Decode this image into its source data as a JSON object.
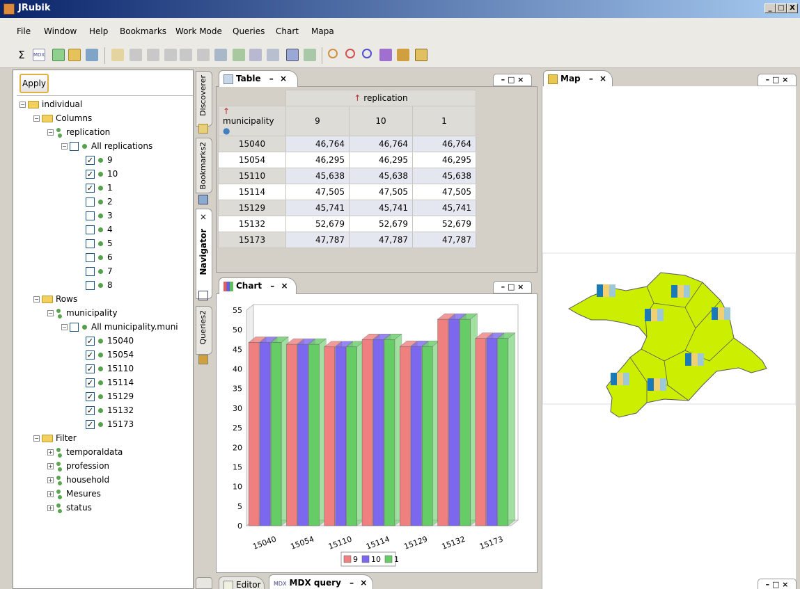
{
  "app": {
    "title": "JRubik"
  },
  "window_buttons": {
    "minimize": "_",
    "maximize": "□",
    "close": "X"
  },
  "menu": [
    "File",
    "Window",
    "Help",
    "Bookmarks",
    "Work Mode",
    "Queries",
    "Chart",
    "Mapa"
  ],
  "toolbar": {
    "sigma_label": "Σ",
    "mdx_label": "MDX"
  },
  "navigator": {
    "apply_label": "Apply",
    "tree": [
      {
        "label": "individual",
        "kind": "folder",
        "level": 0,
        "exp": "−"
      },
      {
        "label": "Columns",
        "kind": "folder",
        "level": 1,
        "exp": "−"
      },
      {
        "label": "replication",
        "kind": "dim",
        "level": 2,
        "exp": "−"
      },
      {
        "label": "All replications",
        "kind": "member",
        "level": 3,
        "exp": "−",
        "checked": false
      },
      {
        "label": "9",
        "kind": "member",
        "level": 4,
        "checked": true
      },
      {
        "label": "10",
        "kind": "member",
        "level": 4,
        "checked": true
      },
      {
        "label": "1",
        "kind": "member",
        "level": 4,
        "checked": true
      },
      {
        "label": "2",
        "kind": "member",
        "level": 4,
        "checked": false
      },
      {
        "label": "3",
        "kind": "member",
        "level": 4,
        "checked": false
      },
      {
        "label": "4",
        "kind": "member",
        "level": 4,
        "checked": false
      },
      {
        "label": "5",
        "kind": "member",
        "level": 4,
        "checked": false
      },
      {
        "label": "6",
        "kind": "member",
        "level": 4,
        "checked": false
      },
      {
        "label": "7",
        "kind": "member",
        "level": 4,
        "checked": false
      },
      {
        "label": "8",
        "kind": "member",
        "level": 4,
        "checked": false
      },
      {
        "label": "Rows",
        "kind": "folder",
        "level": 1,
        "exp": "−"
      },
      {
        "label": "municipality",
        "kind": "dim",
        "level": 2,
        "exp": "−"
      },
      {
        "label": "All municipality.muni",
        "kind": "member",
        "level": 3,
        "exp": "−",
        "checked": false
      },
      {
        "label": "15040",
        "kind": "member",
        "level": 4,
        "checked": true
      },
      {
        "label": "15054",
        "kind": "member",
        "level": 4,
        "checked": true
      },
      {
        "label": "15110",
        "kind": "member",
        "level": 4,
        "checked": true
      },
      {
        "label": "15114",
        "kind": "member",
        "level": 4,
        "checked": true
      },
      {
        "label": "15129",
        "kind": "member",
        "level": 4,
        "checked": true
      },
      {
        "label": "15132",
        "kind": "member",
        "level": 4,
        "checked": true
      },
      {
        "label": "15173",
        "kind": "member",
        "level": 4,
        "checked": true
      },
      {
        "label": "Filter",
        "kind": "folder",
        "level": 1,
        "exp": "−"
      },
      {
        "label": "temporaldata",
        "kind": "dim",
        "level": 2,
        "exp": "+"
      },
      {
        "label": "profession",
        "kind": "dim",
        "level": 2,
        "exp": "+"
      },
      {
        "label": "household",
        "kind": "dim",
        "level": 2,
        "exp": "+"
      },
      {
        "label": "Mesures",
        "kind": "dim",
        "level": 2,
        "exp": "+"
      },
      {
        "label": "status",
        "kind": "dim",
        "level": 2,
        "exp": "+"
      }
    ]
  },
  "side_tabs": [
    "Discoverer",
    "Bookmarks2",
    "Navigator",
    "Queries2"
  ],
  "side_tab_close": "×",
  "table_panel": {
    "tab_label": "Table",
    "column_dim": "replication",
    "row_dim": "municipality",
    "columns": [
      "9",
      "10",
      "1"
    ],
    "rows": [
      {
        "key": "15040",
        "values": [
          "46,764",
          "46,764",
          "46,764"
        ]
      },
      {
        "key": "15054",
        "values": [
          "46,295",
          "46,295",
          "46,295"
        ]
      },
      {
        "key": "15110",
        "values": [
          "45,638",
          "45,638",
          "45,638"
        ]
      },
      {
        "key": "15114",
        "values": [
          "47,505",
          "47,505",
          "47,505"
        ]
      },
      {
        "key": "15129",
        "values": [
          "45,741",
          "45,741",
          "45,741"
        ]
      },
      {
        "key": "15132",
        "values": [
          "52,679",
          "52,679",
          "52,679"
        ]
      },
      {
        "key": "15173",
        "values": [
          "47,787",
          "47,787",
          "47,787"
        ]
      }
    ]
  },
  "chart_panel": {
    "tab_label": "Chart"
  },
  "map_panel": {
    "tab_label": "Map"
  },
  "bottom_tabs": {
    "editor_label": "Editor",
    "mdx_label": "MDX query"
  },
  "panel_controls": {
    "minmax": "– □ ×",
    "close": "×",
    "min": "–"
  },
  "chart_data": {
    "type": "bar",
    "categories": [
      "15040",
      "15054",
      "15110",
      "15114",
      "15129",
      "15132",
      "15173"
    ],
    "series": [
      {
        "name": "9",
        "color": "#f08080",
        "values": [
          46.764,
          46.295,
          45.638,
          47.505,
          45.741,
          52.679,
          47.787
        ]
      },
      {
        "name": "10",
        "color": "#7b68ee",
        "values": [
          46.764,
          46.295,
          45.638,
          47.505,
          45.741,
          52.679,
          47.787
        ]
      },
      {
        "name": "1",
        "color": "#66cc66",
        "values": [
          46.764,
          46.295,
          45.638,
          47.505,
          45.741,
          52.679,
          47.787
        ]
      }
    ],
    "ylim": [
      0,
      55
    ],
    "yticks": [
      0,
      5,
      10,
      15,
      20,
      25,
      30,
      35,
      40,
      45,
      50,
      55
    ],
    "legend_position": "bottom",
    "style": "3d"
  }
}
